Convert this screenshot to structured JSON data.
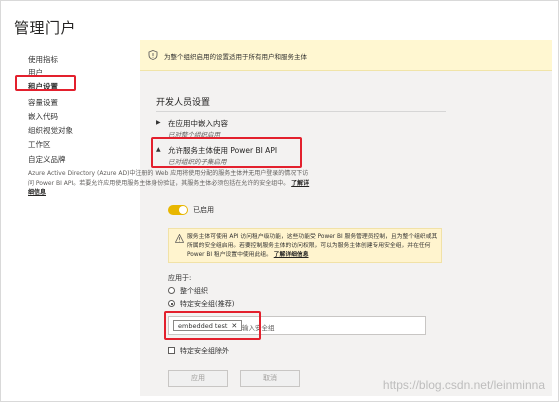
{
  "header": {
    "title": "管理门户"
  },
  "sidebar": {
    "items": [
      {
        "label": "使用指标"
      },
      {
        "label": "用户"
      },
      {
        "label": "租户设置"
      },
      {
        "label": "容量设置"
      },
      {
        "label": "嵌入代码"
      },
      {
        "label": "组织视觉对象"
      },
      {
        "label": "工作区"
      },
      {
        "label": "自定义品牌"
      }
    ],
    "active_index": 2
  },
  "banner": {
    "text": "为整个组织启用的设置适用于所有用户和服务主体"
  },
  "section": {
    "title": "开发人员设置"
  },
  "settings": [
    {
      "title": "在应用中嵌入内容",
      "subtitle": "已对整个组织启用"
    },
    {
      "title": "允许服务主体使用 Power BI API",
      "subtitle": "已对组织的子集启用"
    }
  ],
  "description": {
    "text": "Azure Active Directory (Azure AD)中注册的 Web 应用将使用分配的服务主体并无用户登录的情况下访问 Power BI API。若要允许应用使用服务主体身份验证，其服务主体必须包括在允许的安全组中。",
    "link": "了解详细信息"
  },
  "toggle": {
    "label": "已启用",
    "on": true
  },
  "warning": {
    "text": "服务主体可使用 API 访问租户级功能，这些功能受 Power BI 服务管理员控制，且为整个组织或其所属的安全组启用。若要控制服务主体的访问权限，可以为服务主体创建专用安全组，并在任何 Power BI 租户设置中使用此组。",
    "link": "了解详细信息"
  },
  "apply_to": {
    "label": "应用于:",
    "options": [
      "整个组织",
      "特定安全组(推荐)"
    ],
    "selected_index": 1
  },
  "security_groups": {
    "chips": [
      {
        "label": "embedded test"
      }
    ],
    "placeholder": "输入安全组"
  },
  "exclude": {
    "label": "特定安全组除外",
    "checked": false
  },
  "buttons": {
    "apply": "应用",
    "cancel": "取消"
  },
  "watermark": "https://blog.csdn.net/leinminna",
  "colors": {
    "highlight": "#e3202d",
    "toggle_on": "#e8b700",
    "banner_bg": "#fff7d1"
  }
}
